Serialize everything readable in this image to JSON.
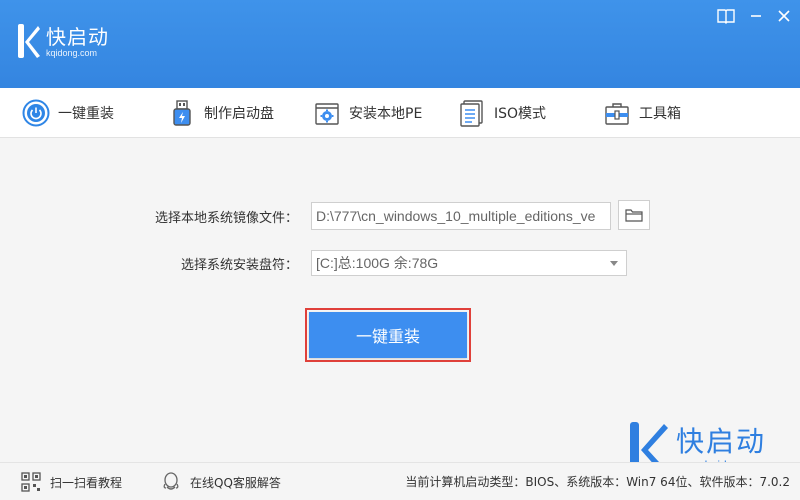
{
  "app": {
    "name": "快启动",
    "url": "kqidong.com"
  },
  "window": {
    "icons": [
      "book-icon",
      "minimize-icon",
      "close-icon"
    ]
  },
  "tabs": [
    {
      "label": "一键重装",
      "icon": "power-icon",
      "active": true
    },
    {
      "label": "制作启动盘",
      "icon": "usb-drive-icon",
      "active": false
    },
    {
      "label": "安装本地PE",
      "icon": "gear-box-icon",
      "active": false
    },
    {
      "label": "ISO模式",
      "icon": "document-list-icon",
      "active": false
    },
    {
      "label": "工具箱",
      "icon": "toolbox-icon",
      "active": false
    }
  ],
  "form": {
    "image_label": "选择本地系统镜像文件：",
    "image_value": "D:\\777\\cn_windows_10_multiple_editions_ve",
    "disk_label": "选择系统安装盘符：",
    "disk_value": "[C:]总:100G 余:78G",
    "main_button": "一键重装"
  },
  "watermark": {
    "name": "快启动",
    "url": "www.kqidong.com"
  },
  "footer": {
    "scan_label": "扫一扫看教程",
    "support_label": "在线QQ客服解答",
    "status": "当前计算机启动类型：BIOS、系统版本：Win7 64位、软件版本：7.0.2"
  },
  "colors": {
    "header": "#3a8ee6",
    "accent": "#3d8ef0",
    "highlight_border": "#e0403a"
  }
}
